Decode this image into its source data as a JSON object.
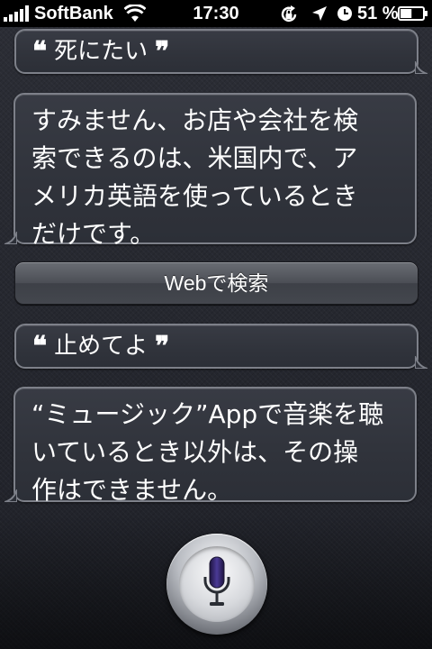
{
  "status_bar": {
    "carrier": "SoftBank",
    "time": "17:30",
    "battery_percent": "51 %",
    "battery_level": 0.51,
    "icons": [
      "signal-bars-icon",
      "wifi-icon",
      "rotation-lock-icon",
      "location-arrow-icon",
      "alarm-clock-icon",
      "battery-icon"
    ]
  },
  "conversation": {
    "user_message_1": "死にたい",
    "assistant_reply_1": {
      "lines": [
        "すみません、お店や会社を検",
        "索できるのは、米国内で、ア",
        "メリカ英語を使っているとき",
        "だけです。"
      ]
    },
    "web_search_button": "Webで検索",
    "user_message_2": "止めてよ",
    "assistant_reply_2": {
      "lines": [
        "“ミュージック”Appで音楽を聴",
        "いているとき以外は、その操",
        "作はできません。"
      ]
    }
  },
  "quote_marks": {
    "open": "❝",
    "close": "❞"
  },
  "mic": {
    "icon": "microphone-icon",
    "accent": "#3b2a7a"
  }
}
